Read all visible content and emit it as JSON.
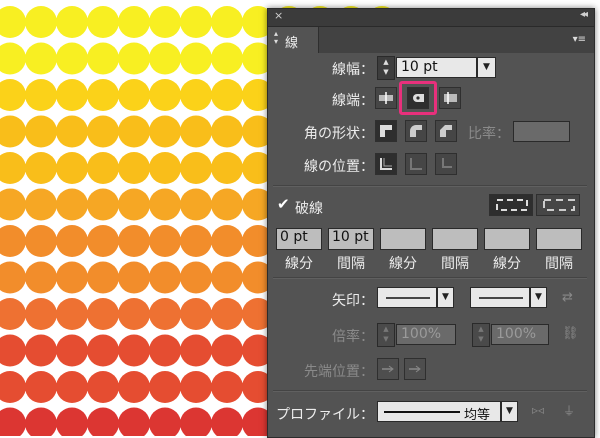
{
  "background": {
    "dot_colors_top_to_bottom": [
      "#f8ef22",
      "#fbd219",
      "#f9be1a",
      "#f6a724",
      "#f28d2b",
      "#ee7132",
      "#e54d31",
      "#dc3632"
    ]
  },
  "panel": {
    "close_symbol": "×",
    "collapse_symbol": "◂◂",
    "tab_label": "線",
    "tab_arrows": "◇",
    "menu_symbol": "▾≡",
    "stroke_weight": {
      "label": "線幅：",
      "value": "10 pt"
    },
    "cap": {
      "label": "線端：",
      "selected": "round-cap"
    },
    "corner": {
      "label": "角の形状：",
      "limit_label": "比率："
    },
    "align": {
      "label": "線の位置："
    },
    "dashed": {
      "checked": true,
      "label": "破線"
    },
    "dash_values": [
      "0 pt",
      "10 pt",
      "",
      "",
      "",
      ""
    ],
    "dash_labels": [
      "線分",
      "間隔",
      "線分",
      "間隔",
      "線分",
      "間隔"
    ],
    "arrowheads": {
      "label": "矢印："
    },
    "scale": {
      "label": "倍率：",
      "start": "100%",
      "end": "100%"
    },
    "arrow_align": {
      "label": "先端位置："
    },
    "profile": {
      "label": "プロファイル：",
      "value": "均等"
    }
  }
}
